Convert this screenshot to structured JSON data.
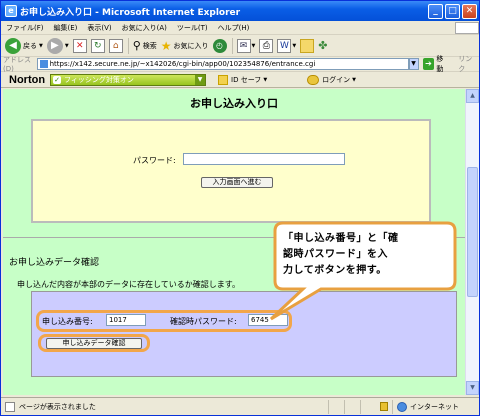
{
  "window": {
    "title": "お申し込み入り口 - Microsoft Internet Explorer"
  },
  "menu": [
    "ファイル(F)",
    "編集(E)",
    "表示(V)",
    "お気に入り(A)",
    "ツール(T)",
    "ヘルプ(H)"
  ],
  "toolbar": {
    "back": "戻る",
    "search": "検索",
    "favorites": "お気に入り"
  },
  "address": {
    "label": "アドレス(D)",
    "url": "https://x142.secure.ne.jp/~x142026/cgi-bin/app00/102354876/entrance.cgi",
    "go": "移動",
    "links": "リンク"
  },
  "norton": {
    "brand": "Norton",
    "phishing": "フィッシング対策オン",
    "idsafe": "ID セーフ",
    "login": "ログイン"
  },
  "page": {
    "title": "お申し込み入り口",
    "password_label": "パスワード:",
    "enter_button": "入力画面へ進む",
    "section_title": "お申し込みデータ確認",
    "section_desc": "申し込んだ内容が本部のデータに存在しているか確認します。",
    "app_no_label": "申し込み番号:",
    "app_no_value": "1017",
    "confirm_pw_label": "確認時パスワード:",
    "confirm_pw_value": "6745",
    "confirm_button": "申し込みデータ確認"
  },
  "callout": {
    "lines": [
      "「申し込み番号」と「確",
      "認時パスワード」を入",
      "力してボタンを押す。"
    ]
  },
  "status": {
    "text": "ページが表示されました",
    "zone": "インターネット"
  }
}
